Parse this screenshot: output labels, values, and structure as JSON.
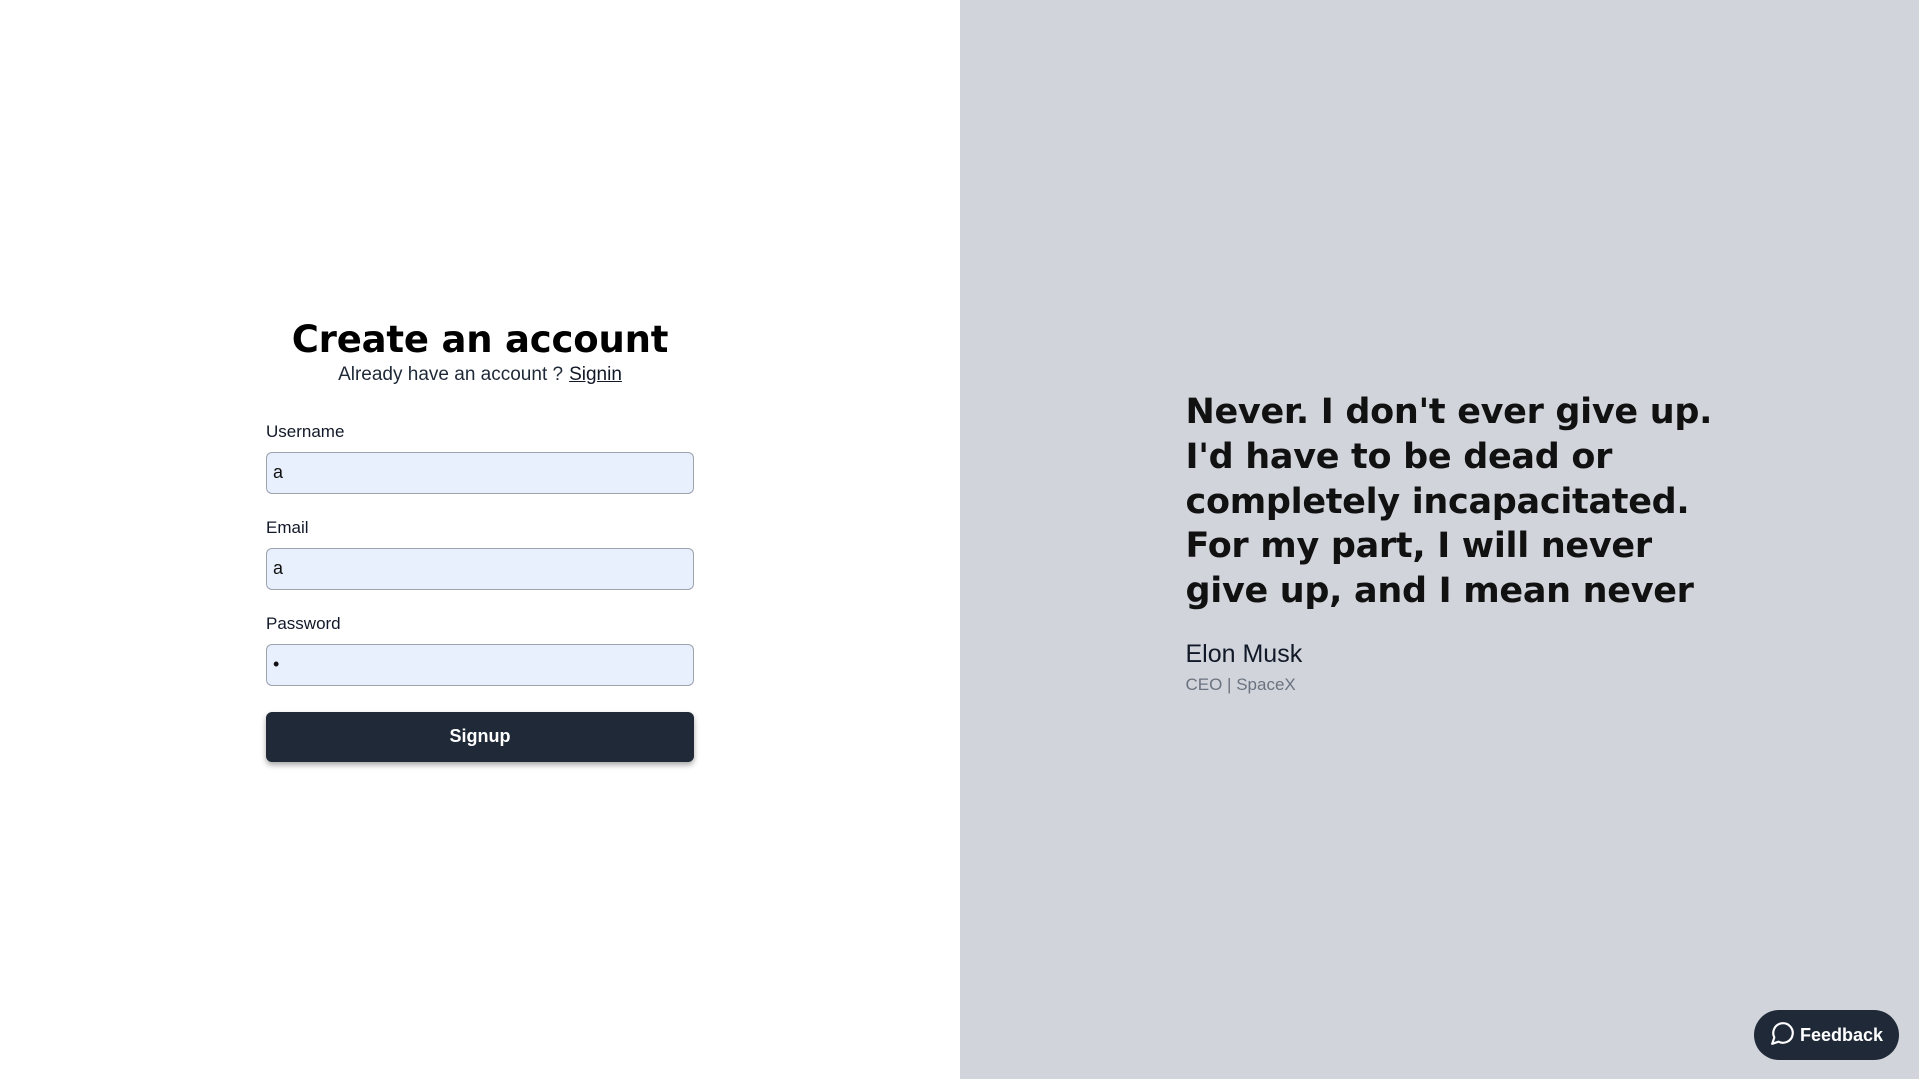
{
  "form": {
    "title": "Create an account",
    "subtitle_text": "Already have an account ?",
    "signin_link": "Signin",
    "fields": [
      {
        "label": "Username",
        "value": "a",
        "type": "text"
      },
      {
        "label": "Email",
        "value": "a",
        "type": "text"
      },
      {
        "label": "Password",
        "value": "a",
        "type": "password"
      }
    ],
    "submit_label": "Signup"
  },
  "testimonial": {
    "quote": "Never. I don't ever give up. I'd have to be dead or completely incapacitated. For my part, I will never give up, and I mean never",
    "author": "Elon Musk",
    "role": "CEO | SpaceX"
  },
  "feedback": {
    "label": "Feedback",
    "icon": "chat-bubble-icon"
  },
  "colors": {
    "left_bg": "#ffffff",
    "right_bg": "#d1d5db",
    "button_bg": "#1f2937",
    "input_bg": "#e8f0fe"
  }
}
